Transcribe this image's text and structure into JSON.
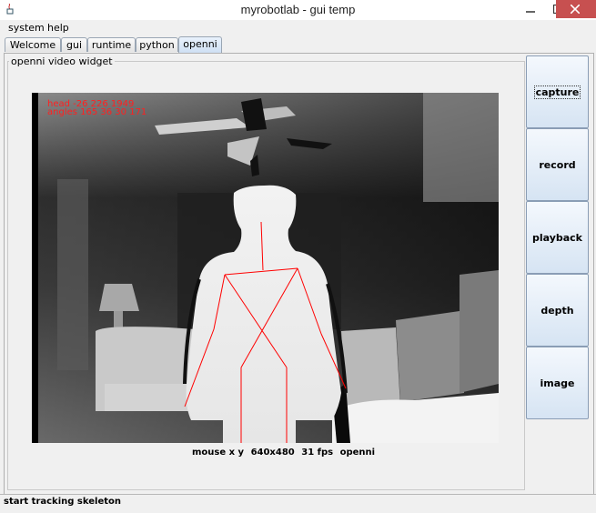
{
  "window": {
    "title": "myrobotlab - gui temp",
    "icon": "java-cup-icon"
  },
  "menu": [
    {
      "label": "system"
    },
    {
      "label": "help"
    }
  ],
  "tabs": [
    {
      "label": "Welcome",
      "active": false
    },
    {
      "label": "gui",
      "active": false
    },
    {
      "label": "runtime",
      "active": false
    },
    {
      "label": "python",
      "active": false
    },
    {
      "label": "openni",
      "active": true
    }
  ],
  "widget": {
    "title": "openni  video widget",
    "overlay": {
      "head": "head -26 226 1949",
      "angles": "angles 165 36 30 171"
    },
    "status": {
      "mouse": "mouse x y",
      "resolution": "640x480",
      "fps": "31 fps",
      "source": "openni"
    }
  },
  "buttons": [
    {
      "label": "capture",
      "focused": true
    },
    {
      "label": "record",
      "focused": false
    },
    {
      "label": "playback",
      "focused": false
    },
    {
      "label": "depth",
      "focused": false
    },
    {
      "label": "image",
      "focused": false
    }
  ],
  "statusbar": {
    "text": "start tracking skeleton"
  },
  "colors": {
    "skeleton": "#ff0000",
    "overlay_text": "#ff2020",
    "close_button": "#c75050"
  }
}
